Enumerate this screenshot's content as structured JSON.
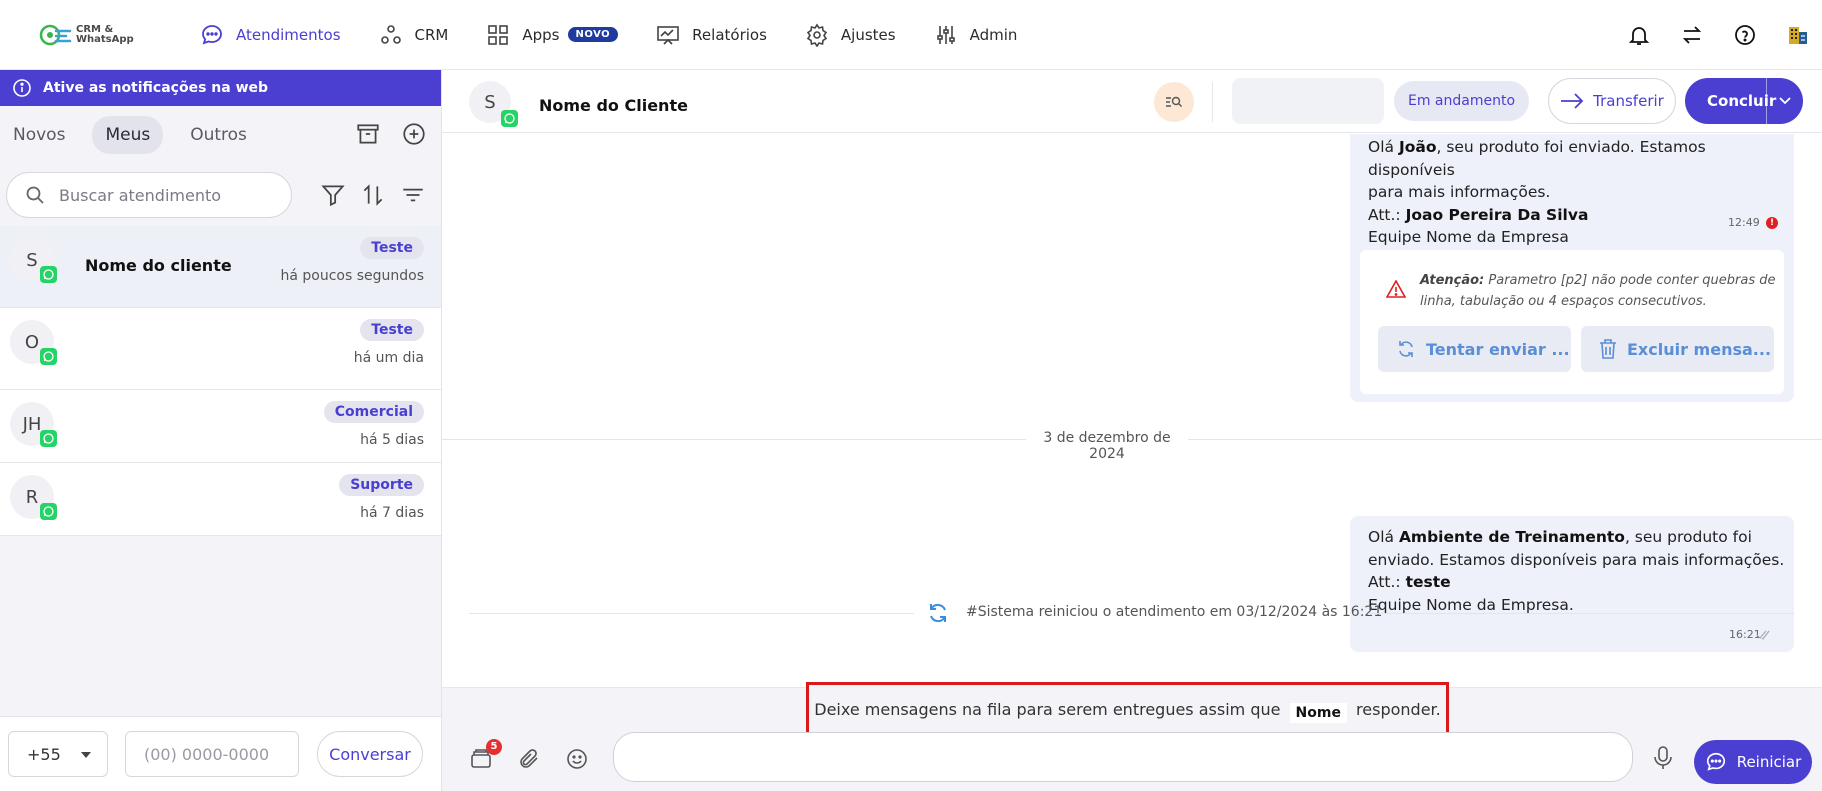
{
  "brand": {
    "logo_line1": "CRM &",
    "logo_line2": "WhatsApp"
  },
  "nav": [
    {
      "label": "Atendimentos",
      "icon": "chat-bubble-icon",
      "active": true
    },
    {
      "label": "CRM",
      "icon": "nodes-icon"
    },
    {
      "label": "Apps",
      "icon": "grid-icon",
      "badge": "NOVO"
    },
    {
      "label": "Relatórios",
      "icon": "chart-board-icon"
    },
    {
      "label": "Ajustes",
      "icon": "gear-icon"
    },
    {
      "label": "Admin",
      "icon": "sliders-icon"
    }
  ],
  "sidebar": {
    "notification": "Ative as notificações na web",
    "tabs": [
      "Novos",
      "Meus",
      "Outros"
    ],
    "active_tab": "Meus",
    "search_placeholder": "Buscar atendimento",
    "conversations": [
      {
        "initials": "S",
        "name": "Nome do cliente",
        "tag": "Teste",
        "time": "há poucos segundos"
      },
      {
        "initials": "O",
        "name": "",
        "tag": "Teste",
        "time": "há um dia"
      },
      {
        "initials": "JH",
        "name": "",
        "tag": "Comercial",
        "time": "há 5 dias"
      },
      {
        "initials": "R",
        "name": "",
        "tag": "Suporte",
        "time": "há 7 dias"
      }
    ],
    "country_code": "+55",
    "phone_placeholder": "(00) 0000-0000",
    "start_button": "Conversar"
  },
  "chat": {
    "initials": "S",
    "client_name": "Nome do Cliente",
    "status": "Em andamento",
    "transfer_label": "Transferir",
    "conclude_label": "Concluir",
    "msg1": {
      "l1a": "Olá ",
      "l1b": "João",
      "l1c": ", seu produto foi enviado. Estamos disponíveis",
      "l2": "para mais informações.",
      "l3a": "Att.: ",
      "l3b": "Joao Pereira Da Silva",
      "l4": "Equipe Nome da Empresa",
      "time": "12:49",
      "error_mark": "!"
    },
    "error": {
      "title": "Atenção:",
      "text": " Parametro [p2] não pode conter quebras de linha, tabulação ou 4 espaços consecutivos.",
      "retry": "Tentar enviar ...",
      "delete": "Excluir mensa..."
    },
    "date_label": "3 de dezembro de 2024",
    "msg2": {
      "l1a": "Olá ",
      "l1b": "Ambiente de Treinamento",
      "l1c": ", seu produto foi",
      "l2": "enviado. Estamos disponíveis para mais informações.",
      "l3a": "Att.: ",
      "l3b": "teste",
      "l4": "Equipe Nome da Empresa.",
      "time": "16:21"
    },
    "system_message": "#Sistema reiniciou o atendimento em 03/12/2024 às 16:21",
    "notice_pre": "Deixe mensagens na fila para serem entregues assim que ",
    "notice_name": "Nome",
    "notice_post": " responder.",
    "queue_count": "5",
    "restart_label": "Reiniciar"
  },
  "colors": {
    "accent": "#4a3fd1",
    "whatsapp": "#25d366",
    "error": "#e02020",
    "bubble": "#eef0fa"
  }
}
